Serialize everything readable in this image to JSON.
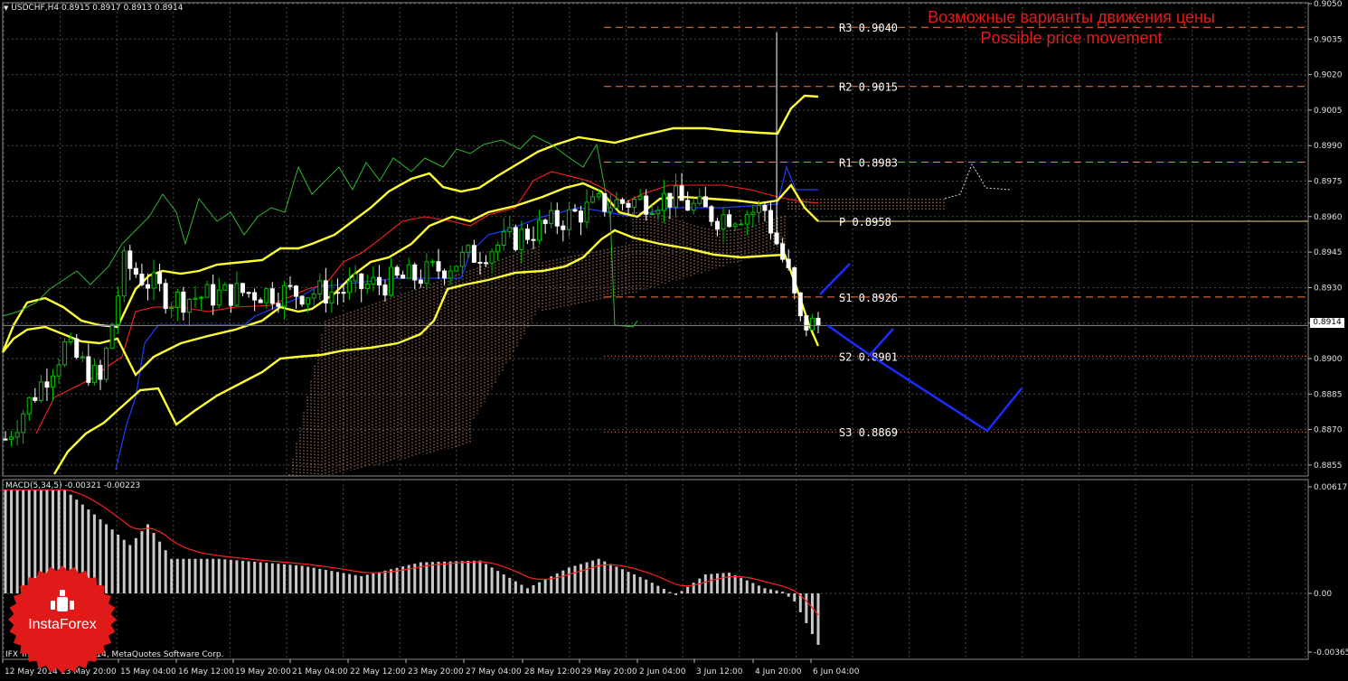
{
  "header": {
    "symbol_info": "USDCHF,H4  0.8915 0.8917 0.8913 0.8914",
    "macd_info": "MACD(5,34,5) -0.00321 -0.00223",
    "footer_copyright": "IFX Trader, © 2001-2014, MetaQuotes Software Corp."
  },
  "annotation": {
    "line_ru": "Возможные варианты движения цены",
    "line_en": "Possible price movement"
  },
  "brand": {
    "logo_text": "InstaForex"
  },
  "colors": {
    "background": "#000000",
    "grid": "#4a4a4a",
    "bull": "#00c000",
    "bear": "#ffffff",
    "bollinger": "#ffff33",
    "tenkan": "#ff2020",
    "kijun": "#1e3cff",
    "chikou": "#2eb82e",
    "cloud": "#f0a070",
    "level_line": "#ff7a3a",
    "pivot_line": "#f0d090",
    "forecast": "#1a2cff",
    "macd_hist": "#c8c8c8",
    "macd_signal": "#ff2020",
    "annotation": "#e31b1b",
    "logo": "#e01919"
  },
  "current_price_label": "0.8914",
  "chart_data": [
    {
      "type": "candlestick",
      "title": "USDCHF,H4",
      "ylim": [
        0.8848,
        0.905
      ],
      "y_ticks": [
        "0.9050",
        "0.9035",
        "0.9020",
        "0.9005",
        "0.8990",
        "0.8975",
        "0.8960",
        "0.8945",
        "0.8930",
        "0.8915",
        "0.8900",
        "0.8885",
        "0.8870",
        "0.8855"
      ],
      "x_ticks": [
        "12 May 2014",
        "13 May 20:00",
        "15 May 04:00",
        "16 May 12:00",
        "19 May 20:00",
        "21 May 04:00",
        "22 May 12:00",
        "23 May 20:00",
        "27 May 04:00",
        "28 May 12:00",
        "29 May 20:00",
        "2 Jun 04:00",
        "3 Jun 12:00",
        "4 Jun 20:00",
        "6 Jun 04:00"
      ],
      "levels": [
        {
          "name": "R3",
          "value": 0.904,
          "label": "R3 0.9040",
          "style": "dash"
        },
        {
          "name": "R2",
          "value": 0.9015,
          "label": "R2 0.9015",
          "style": "dash"
        },
        {
          "name": "R1",
          "value": 0.8983,
          "label": "R1 0.8983",
          "style": "dash"
        },
        {
          "name": "P",
          "value": 0.8958,
          "label": "P 0.8958",
          "style": "solid"
        },
        {
          "name": "S1",
          "value": 0.8926,
          "label": "S1 0.8926",
          "style": "dash"
        },
        {
          "name": "S2",
          "value": 0.8901,
          "label": "S2 0.8901",
          "style": "dot"
        },
        {
          "name": "S3",
          "value": 0.8869,
          "label": "S3 0.8869",
          "style": "dot"
        }
      ],
      "current_price": 0.8914
    },
    {
      "type": "bar",
      "title": "MACD(5,34,5)",
      "series": [
        {
          "name": "MACD",
          "value": -0.00321
        },
        {
          "name": "Signal",
          "value": -0.00223
        }
      ],
      "ylim": [
        -0.00365,
        0.00617
      ],
      "y_ticks": [
        "0.00617",
        "0.00",
        "-0.00365"
      ]
    }
  ]
}
